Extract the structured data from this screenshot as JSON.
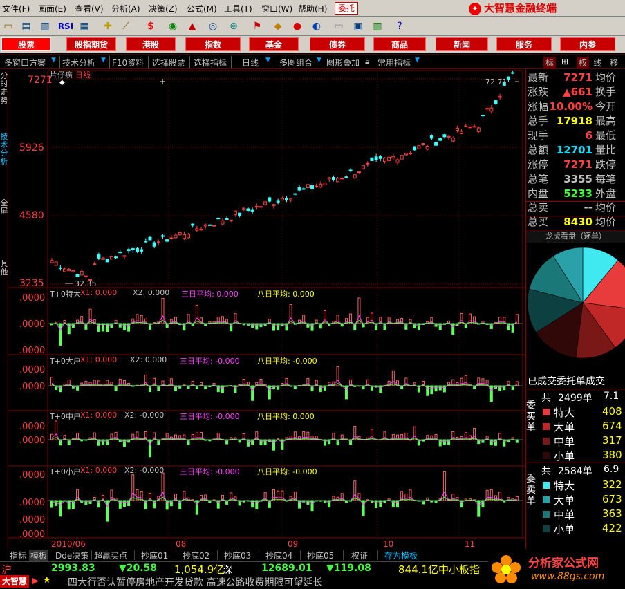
{
  "menus": [
    "文件(F)",
    "画面(E)",
    "查看(V)",
    "分析(A)",
    "决策(Z)",
    "公式(M)",
    "工具(T)",
    "窗口(W)",
    "帮助(H)"
  ],
  "trust_label": "委托",
  "brand": "大智慧金融终端",
  "nav_buttons": [
    "股票",
    "股指期货",
    "港股",
    "指数",
    "基金",
    "债券",
    "商品",
    "新闻",
    "服务",
    "内参"
  ],
  "func_bar": {
    "items": [
      "多窗口方案",
      "技术分析",
      "F10资料",
      "选择股票",
      "选择指标",
      "日线",
      "多图组合",
      "图形叠加",
      "常用指标"
    ],
    "right_tabs": [
      "标",
      "权",
      "线",
      "移"
    ]
  },
  "side_tabs": [
    "分时走势",
    "技术分析",
    "全屏",
    "其他"
  ],
  "chart": {
    "stock_name": "片仔癀",
    "period": "日线",
    "price_ticks": [
      "7271",
      "5926",
      "4580",
      "3235"
    ],
    "high_label": "72.71",
    "low_label": "32.35",
    "indicators": [
      {
        "name": "T+0特大",
        "x1": "X1: 0.000",
        "x2": "X2: 0.000",
        "avg3": "三日平均: 0.000",
        "avg8": "八日平均: 0.000",
        "ticks": [
          ".0000",
          ".0000",
          ".0000"
        ]
      },
      {
        "name": "T+0大户",
        "x1": "X1: 0.000",
        "x2": "X2: 0.000",
        "avg3": "三日平均: -0.000",
        "avg8": "八日平均: -0.000",
        "ticks": [
          ".0000",
          ".0000"
        ]
      },
      {
        "name": "T+0中户",
        "x1": "X1: 0.000",
        "x2": "X2: -0.000",
        "avg3": "三日平均: -0.000",
        "avg8": "八日平均: 0.000",
        "ticks": [
          ".0000",
          ".0000"
        ]
      },
      {
        "name": "T+0小户",
        "x1": "X1: 0.000",
        "x2": "X2: -0.000",
        "avg3": "三日平均: -0.000",
        "avg8": "八日平均: -0.000",
        "ticks": [
          ".0000",
          ".0000",
          ".0000",
          ".0000"
        ]
      }
    ],
    "date_labels": [
      "2010/06",
      "08",
      "09",
      "10",
      "11"
    ]
  },
  "quote": {
    "rows": [
      {
        "label": "最新",
        "value": "7271",
        "value_color": "#ff4040",
        "right": "均价"
      },
      {
        "label": "涨跌",
        "value": "▲661",
        "value_color": "#ff4040",
        "right": "换手"
      },
      {
        "label": "涨幅",
        "value": "10.00%",
        "value_color": "#ff4040",
        "right": "今开"
      },
      {
        "label": "总手",
        "value": "17918",
        "value_color": "#ffff00",
        "right": "最高"
      },
      {
        "label": "现手",
        "value": "6",
        "value_color": "#ff4040",
        "right": "最低"
      },
      {
        "label": "总额",
        "value": "12701",
        "value_color": "#00e0ff",
        "right": "量比"
      },
      {
        "label": "涨停",
        "value": "7271",
        "value_color": "#ff4040",
        "right": "跌停"
      },
      {
        "label": "总笔",
        "value": "3355",
        "value_color": "#c0c0c0",
        "right": "每笔"
      },
      {
        "label": "内盘",
        "value": "5233",
        "value_color": "#40ff40",
        "right": "外盘"
      },
      {
        "label": "总卖",
        "value": "--",
        "value_color": "#c0c0c0",
        "right": "均价"
      },
      {
        "label": "总买",
        "value": "8430",
        "value_color": "#ffff00",
        "right": "均价"
      }
    ],
    "dragon_title": "龙虎看盘（逐单）",
    "pie": [
      {
        "value": 0.11,
        "color": "#40e8f0"
      },
      {
        "value": 0.16,
        "color": "#e83c3c"
      },
      {
        "value": 0.13,
        "color": "#c02828"
      },
      {
        "value": 0.12,
        "color": "#7a1818"
      },
      {
        "value": 0.14,
        "color": "#300808"
      },
      {
        "value": 0.13,
        "color": "#0d4040"
      },
      {
        "value": 0.12,
        "color": "#1a7878"
      },
      {
        "value": 0.09,
        "color": "#2aa0a8"
      }
    ],
    "orders_title": "已成交委托单成交",
    "buy": {
      "total_label": "共",
      "total": "2499单",
      "total_right": "7.1",
      "side": "委买单",
      "items": [
        {
          "label": "特大",
          "value": "408",
          "color": "#e83c3c"
        },
        {
          "label": "大单",
          "value": "674",
          "color": "#c02828"
        },
        {
          "label": "中单",
          "value": "317",
          "color": "#7a1818"
        },
        {
          "label": "小单",
          "value": "380",
          "color": "#300808"
        }
      ]
    },
    "sell": {
      "total_label": "共",
      "total": "2584单",
      "total_right": "6.9",
      "side": "委卖单",
      "items": [
        {
          "label": "特大",
          "value": "322",
          "color": "#40e8f0"
        },
        {
          "label": "大单",
          "value": "673",
          "color": "#2aa0a8"
        },
        {
          "label": "中单",
          "value": "363",
          "color": "#1a7878"
        },
        {
          "label": "小单",
          "value": "422",
          "color": "#0d4040"
        }
      ]
    }
  },
  "bottom_tabs": [
    "指标",
    "模板",
    "Dde决策",
    "超赢买点",
    "抄底01",
    "抄底02",
    "抄底03",
    "抄底04",
    "抄底05",
    "权证",
    "存为模板"
  ],
  "index_bar": {
    "sh_label": "沪",
    "sh_value": "2993.83",
    "sh_change": "▼20.58",
    "sh_amount": "1,054.9亿",
    "sz_label": "深",
    "sz_value": "12689.01",
    "sz_change": "▼119.08",
    "sz_amount": "844.1亿",
    "board": "中小板指"
  },
  "ticker": {
    "logo": "大智慧",
    "text": "四大行否认暂停房地产开发贷款 高速公路收费期限可望延长"
  },
  "watermark": {
    "title": "分析家公式网",
    "url": "www.88gs.com"
  },
  "colors": {
    "up": "#ff4040",
    "down": "#40ff40",
    "grid": "#800000",
    "accent": "#00e0ff"
  }
}
